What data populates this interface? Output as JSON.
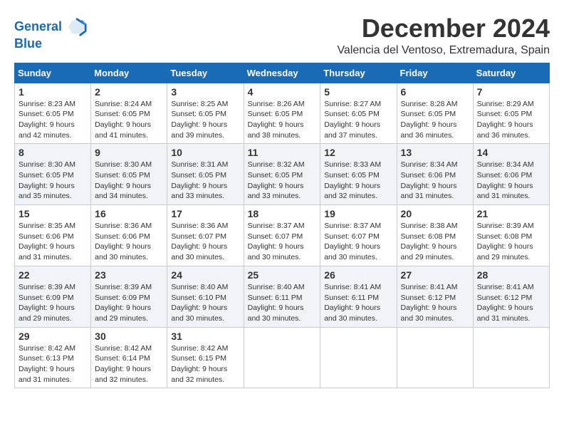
{
  "header": {
    "logo_line1": "General",
    "logo_line2": "Blue",
    "month_year": "December 2024",
    "location": "Valencia del Ventoso, Extremadura, Spain"
  },
  "weekdays": [
    "Sunday",
    "Monday",
    "Tuesday",
    "Wednesday",
    "Thursday",
    "Friday",
    "Saturday"
  ],
  "weeks": [
    [
      {
        "day": "1",
        "sunrise": "8:23 AM",
        "sunset": "6:05 PM",
        "daylight": "9 hours and 42 minutes."
      },
      {
        "day": "2",
        "sunrise": "8:24 AM",
        "sunset": "6:05 PM",
        "daylight": "9 hours and 41 minutes."
      },
      {
        "day": "3",
        "sunrise": "8:25 AM",
        "sunset": "6:05 PM",
        "daylight": "9 hours and 39 minutes."
      },
      {
        "day": "4",
        "sunrise": "8:26 AM",
        "sunset": "6:05 PM",
        "daylight": "9 hours and 38 minutes."
      },
      {
        "day": "5",
        "sunrise": "8:27 AM",
        "sunset": "6:05 PM",
        "daylight": "9 hours and 37 minutes."
      },
      {
        "day": "6",
        "sunrise": "8:28 AM",
        "sunset": "6:05 PM",
        "daylight": "9 hours and 36 minutes."
      },
      {
        "day": "7",
        "sunrise": "8:29 AM",
        "sunset": "6:05 PM",
        "daylight": "9 hours and 36 minutes."
      }
    ],
    [
      {
        "day": "8",
        "sunrise": "8:30 AM",
        "sunset": "6:05 PM",
        "daylight": "9 hours and 35 minutes."
      },
      {
        "day": "9",
        "sunrise": "8:30 AM",
        "sunset": "6:05 PM",
        "daylight": "9 hours and 34 minutes."
      },
      {
        "day": "10",
        "sunrise": "8:31 AM",
        "sunset": "6:05 PM",
        "daylight": "9 hours and 33 minutes."
      },
      {
        "day": "11",
        "sunrise": "8:32 AM",
        "sunset": "6:05 PM",
        "daylight": "9 hours and 33 minutes."
      },
      {
        "day": "12",
        "sunrise": "8:33 AM",
        "sunset": "6:05 PM",
        "daylight": "9 hours and 32 minutes."
      },
      {
        "day": "13",
        "sunrise": "8:34 AM",
        "sunset": "6:06 PM",
        "daylight": "9 hours and 31 minutes."
      },
      {
        "day": "14",
        "sunrise": "8:34 AM",
        "sunset": "6:06 PM",
        "daylight": "9 hours and 31 minutes."
      }
    ],
    [
      {
        "day": "15",
        "sunrise": "8:35 AM",
        "sunset": "6:06 PM",
        "daylight": "9 hours and 31 minutes."
      },
      {
        "day": "16",
        "sunrise": "8:36 AM",
        "sunset": "6:06 PM",
        "daylight": "9 hours and 30 minutes."
      },
      {
        "day": "17",
        "sunrise": "8:36 AM",
        "sunset": "6:07 PM",
        "daylight": "9 hours and 30 minutes."
      },
      {
        "day": "18",
        "sunrise": "8:37 AM",
        "sunset": "6:07 PM",
        "daylight": "9 hours and 30 minutes."
      },
      {
        "day": "19",
        "sunrise": "8:37 AM",
        "sunset": "6:07 PM",
        "daylight": "9 hours and 30 minutes."
      },
      {
        "day": "20",
        "sunrise": "8:38 AM",
        "sunset": "6:08 PM",
        "daylight": "9 hours and 29 minutes."
      },
      {
        "day": "21",
        "sunrise": "8:39 AM",
        "sunset": "6:08 PM",
        "daylight": "9 hours and 29 minutes."
      }
    ],
    [
      {
        "day": "22",
        "sunrise": "8:39 AM",
        "sunset": "6:09 PM",
        "daylight": "9 hours and 29 minutes."
      },
      {
        "day": "23",
        "sunrise": "8:39 AM",
        "sunset": "6:09 PM",
        "daylight": "9 hours and 29 minutes."
      },
      {
        "day": "24",
        "sunrise": "8:40 AM",
        "sunset": "6:10 PM",
        "daylight": "9 hours and 30 minutes."
      },
      {
        "day": "25",
        "sunrise": "8:40 AM",
        "sunset": "6:11 PM",
        "daylight": "9 hours and 30 minutes."
      },
      {
        "day": "26",
        "sunrise": "8:41 AM",
        "sunset": "6:11 PM",
        "daylight": "9 hours and 30 minutes."
      },
      {
        "day": "27",
        "sunrise": "8:41 AM",
        "sunset": "6:12 PM",
        "daylight": "9 hours and 30 minutes."
      },
      {
        "day": "28",
        "sunrise": "8:41 AM",
        "sunset": "6:12 PM",
        "daylight": "9 hours and 31 minutes."
      }
    ],
    [
      {
        "day": "29",
        "sunrise": "8:42 AM",
        "sunset": "6:13 PM",
        "daylight": "9 hours and 31 minutes."
      },
      {
        "day": "30",
        "sunrise": "8:42 AM",
        "sunset": "6:14 PM",
        "daylight": "9 hours and 32 minutes."
      },
      {
        "day": "31",
        "sunrise": "8:42 AM",
        "sunset": "6:15 PM",
        "daylight": "9 hours and 32 minutes."
      },
      null,
      null,
      null,
      null
    ]
  ]
}
